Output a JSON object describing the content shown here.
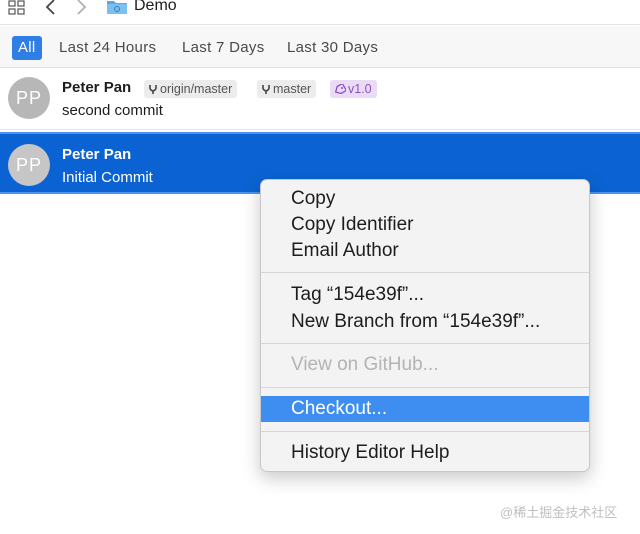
{
  "toolbar": {
    "repo_title": "Demo",
    "icons": [
      "grid-icon",
      "back-arrow-icon",
      "forward-arrow-icon",
      "folder-icon"
    ]
  },
  "filters": {
    "items": [
      "All",
      "Last 24 Hours",
      "Last 7 Days",
      "Last 30 Days"
    ],
    "active": "All"
  },
  "commits": [
    {
      "initials": "PP",
      "author": "Peter Pan",
      "message": "second commit",
      "refs": [
        {
          "type": "branch",
          "label": "origin/master"
        },
        {
          "type": "branch",
          "label": "master"
        },
        {
          "type": "tag",
          "label": "v1.0"
        }
      ],
      "selected": false
    },
    {
      "initials": "PP",
      "author": "Peter Pan",
      "message": "Initial Commit",
      "refs": [],
      "selected": true
    }
  ],
  "context_menu": {
    "items": [
      {
        "label": "Copy",
        "state": "normal"
      },
      {
        "label": "Copy Identifier",
        "state": "normal"
      },
      {
        "label": "Email Author",
        "state": "normal"
      },
      {
        "label": "Tag “154e39f”...",
        "state": "normal"
      },
      {
        "label": "New Branch from “154e39f”...",
        "state": "normal"
      },
      {
        "label": "View on GitHub...",
        "state": "disabled"
      },
      {
        "label": "Checkout...",
        "state": "highlighted"
      },
      {
        "label": "History Editor Help",
        "state": "normal"
      }
    ]
  },
  "watermark": "@稀土掘金技术社区",
  "colors": {
    "accent": "#2f7ee6",
    "selection": "#0b63d3",
    "menu_highlight": "#3d8ef0",
    "tag_text": "#8e4ec6",
    "tag_bg": "#eadcf7"
  }
}
